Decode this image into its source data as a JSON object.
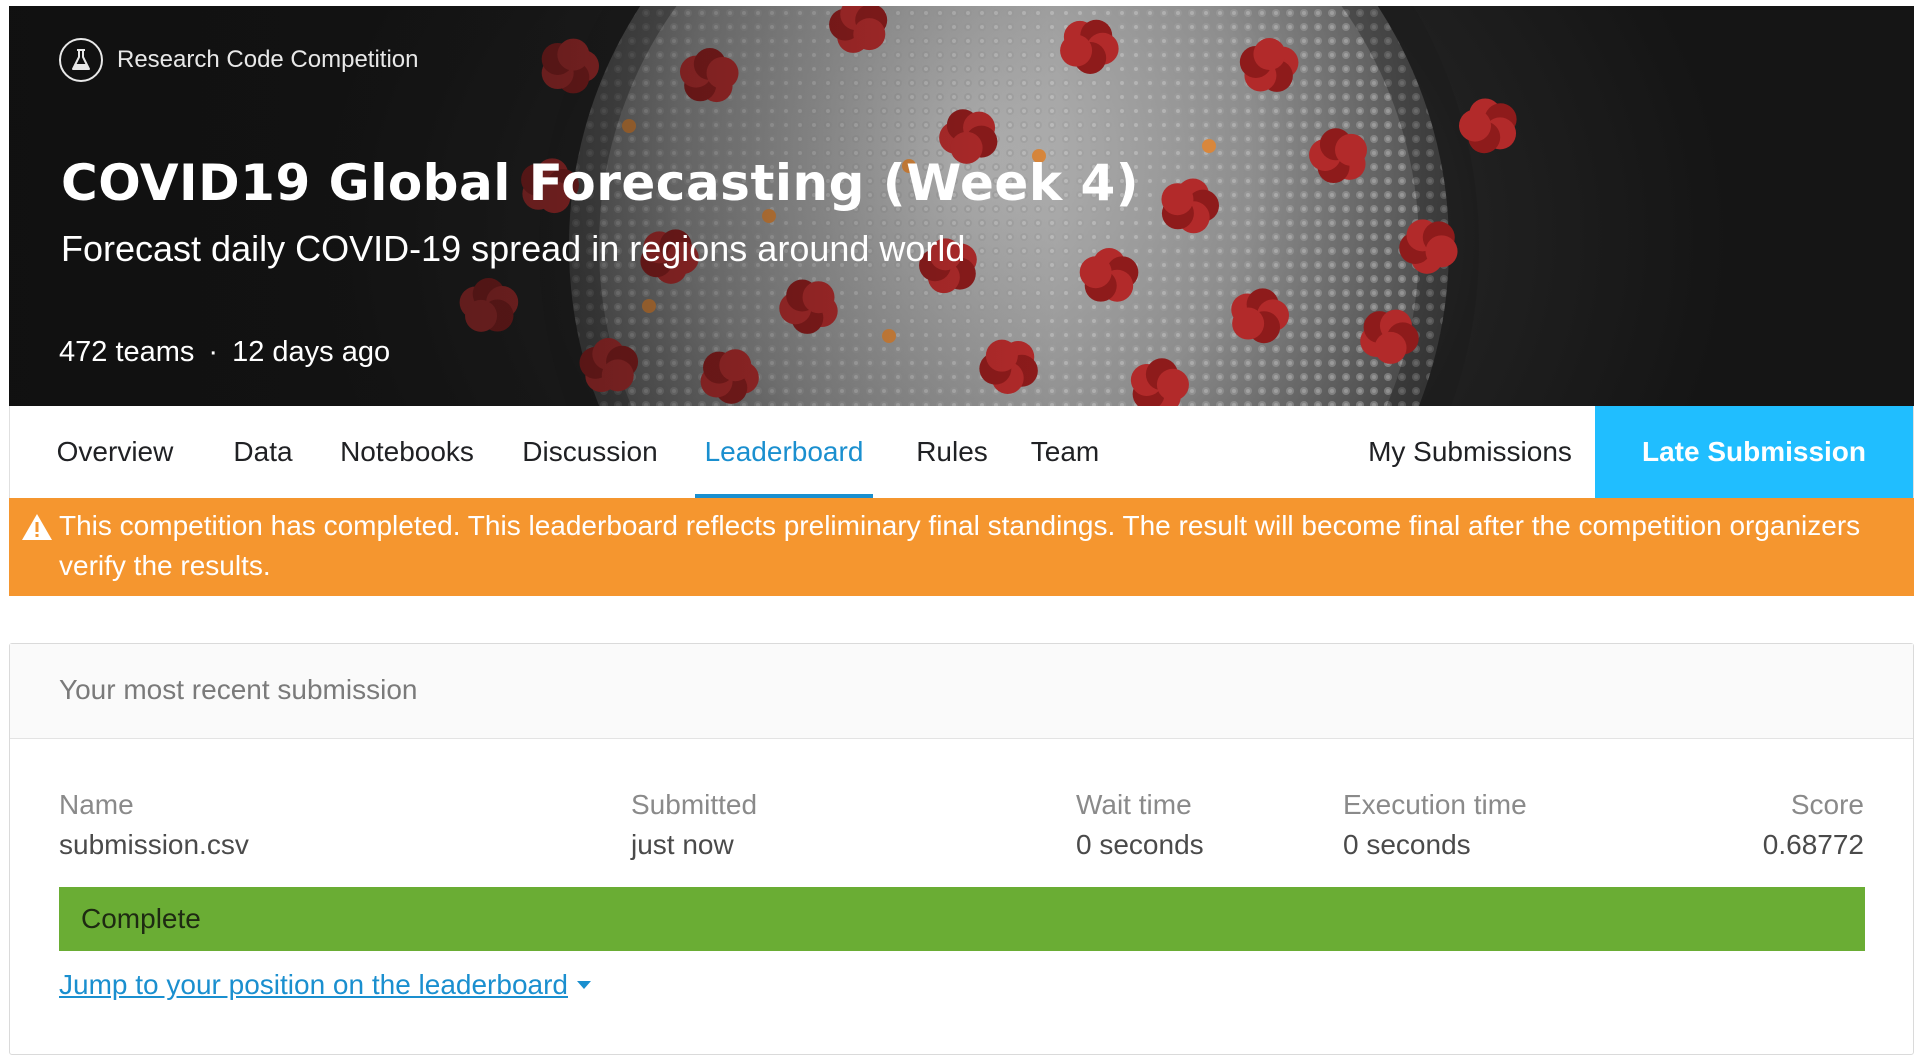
{
  "header": {
    "competition_type": "Research Code Competition",
    "flask_icon": "flask-icon",
    "title": "COVID19 Global Forecasting (Week 4)",
    "subtitle": "Forecast daily COVID-19 spread in regions around world",
    "teams": "472 teams",
    "separator": "·",
    "time_ago": "12 days ago"
  },
  "tabs": [
    {
      "label": "Overview",
      "active": false
    },
    {
      "label": "Data",
      "active": false
    },
    {
      "label": "Notebooks",
      "active": false
    },
    {
      "label": "Discussion",
      "active": false
    },
    {
      "label": "Leaderboard",
      "active": true
    },
    {
      "label": "Rules",
      "active": false
    },
    {
      "label": "Team",
      "active": false
    }
  ],
  "my_submissions_label": "My Submissions",
  "late_submission_label": "Late Submission",
  "alert": {
    "icon": "warning-icon",
    "text": "This competition has completed. This leaderboard reflects preliminary final standings. The result will become final after the competition organizers verify the results."
  },
  "submission": {
    "heading": "Your most recent submission",
    "name_label": "Name",
    "name_value": "submission.csv",
    "submitted_label": "Submitted",
    "submitted_value": "just now",
    "wait_label": "Wait time",
    "wait_value": "0 seconds",
    "exec_label": "Execution time",
    "exec_value": "0 seconds",
    "score_label": "Score",
    "score_value": "0.68772",
    "status": "Complete",
    "jump_link": "Jump to your position on the leaderboard"
  },
  "colors": {
    "accent": "#20beff",
    "link": "#1a8fcf",
    "alert": "#f5962f",
    "complete": "#6aad34"
  }
}
